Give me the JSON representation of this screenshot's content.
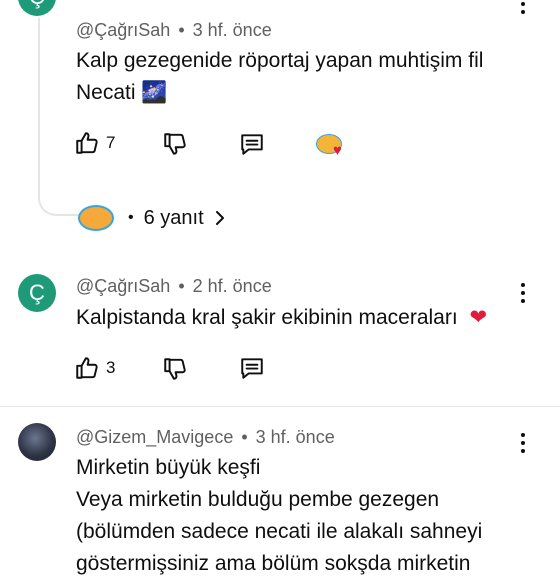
{
  "colors": {
    "avatar_teal": "#1f9a78",
    "heart_red": "#e01b3c"
  },
  "comment1": {
    "avatar_letter": "Ç",
    "author": "@ÇağrıSah",
    "time": "3 hf. önce",
    "text_line1": "Kalp gezegenide röportaj yapan muhtişim fil",
    "text_line2": "Necati",
    "emoji": "🌌",
    "likes": "7",
    "replies": "6 yanıt"
  },
  "comment2": {
    "avatar_letter": "Ç",
    "author": "@ÇağrıSah",
    "time": "2 hf. önce",
    "text": "Kalpistanda kral şakir ekibinin maceraları",
    "emoji": "❤️",
    "likes": "3"
  },
  "comment3": {
    "author": "@Gizem_Mavigece",
    "time": "3 hf. önce",
    "lines": [
      "Mirketin büyük keşfi",
      "Veya mirketin bulduğu pembe gezegen",
      "(bölümden sadece necati ile alakalı sahneyi",
      "göstermişsiniz ama bölüm sokşda mirketin"
    ]
  },
  "icons": [
    "like-icon",
    "dislike-icon",
    "reply-icon",
    "creator-heart-icon",
    "chevron-right-icon",
    "more-options-icon"
  ]
}
